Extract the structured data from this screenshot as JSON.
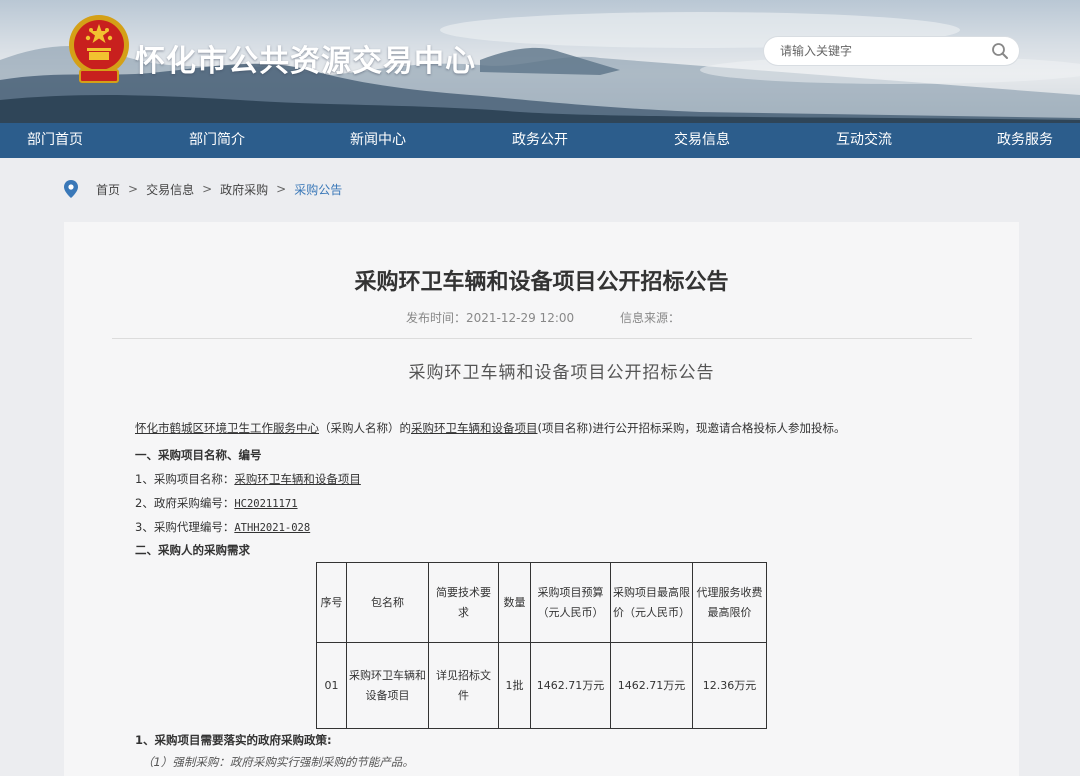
{
  "site": {
    "title": "怀化市公共资源交易中心"
  },
  "search": {
    "placeholder": "请输入关键字"
  },
  "nav": [
    "部门首页",
    "部门简介",
    "新闻中心",
    "政务公开",
    "交易信息",
    "互动交流",
    "政务服务"
  ],
  "breadcrumb": [
    "首页",
    "交易信息",
    "政府采购",
    "采购公告"
  ],
  "article": {
    "title": "采购环卫车辆和设备项目公开招标公告",
    "publish_time": "发布时间：2021-12-29 12:00",
    "source": "信息来源：",
    "subtitle": "采购环卫车辆和设备项目公开招标公告",
    "intro": {
      "purchaser": "怀化市鹤城区环境卫生工作服务中心",
      "purchaser_note": "（采购人名称）的",
      "project": "采购环卫车辆和设备项目",
      "project_note": "(项目名称)进行公开招标采购，现邀请合格投标人参加投标。"
    },
    "section1": "一、采购项目名称、编号",
    "item1_label": "1、采购项目名称：",
    "item1_value": "采购环卫车辆和设备项目",
    "item2_label": "2、政府采购编号：",
    "item2_value": "HC20211171",
    "item3_label": "3、采购代理编号：",
    "item3_value": "ATHH2021-028",
    "section2": "二、采购人的采购需求",
    "table": {
      "headers": [
        "序号",
        "包名称",
        "简要技术要求",
        "数量",
        "采购项目预算（元人民币）",
        "采购项目最高限价（元人民币）",
        "代理服务收费最高限价"
      ],
      "rows": [
        [
          "01",
          "采购环卫车辆和设备项目",
          "详见招标文件",
          "1批",
          "1462.71万元",
          "1462.71万元",
          "12.36万元"
        ]
      ]
    },
    "policy_label": "1、采购项目需要落实的政府采购政策:",
    "policy_item": "（1）强制采购：政府采购实行强制采购的节能产品。"
  },
  "colors": {
    "nav_bg": "#2c5d8c",
    "link": "#3a78b8"
  }
}
